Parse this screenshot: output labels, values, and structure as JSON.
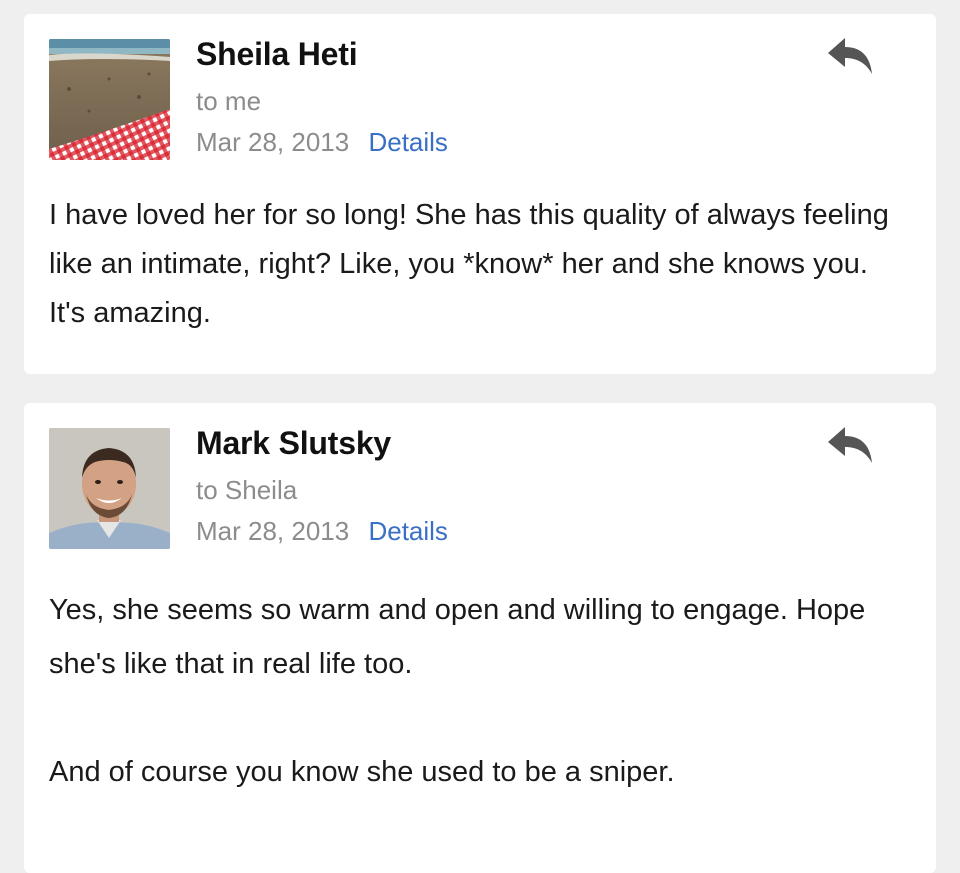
{
  "messages": [
    {
      "sender": "Sheila Heti",
      "recipient": "to me",
      "date": "Mar 28, 2013",
      "details_label": "Details",
      "reply_icon": "reply-icon",
      "body": "I have loved her for so long! She has this quality of always feeling like an intimate, right? Like, you *know* her and she knows you. It's amazing."
    },
    {
      "sender": "Mark Slutsky",
      "recipient": "to Sheila",
      "date": "Mar 28, 2013",
      "details_label": "Details",
      "reply_icon": "reply-icon",
      "body_paragraphs": [
        "Yes, she seems so warm and open and willing to engage. Hope she's like that in real life too.",
        "And of course you know she used to be a sniper."
      ]
    }
  ],
  "colors": {
    "background": "#efefef",
    "card": "#ffffff",
    "link": "#3a6fc6",
    "muted": "#8c8c8c",
    "text": "#1a1a1a"
  }
}
